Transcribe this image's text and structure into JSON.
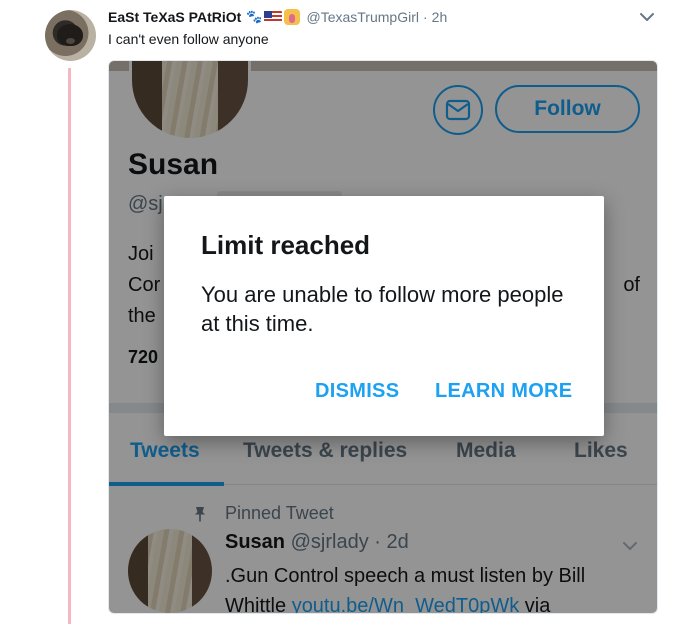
{
  "tweet": {
    "display_name": "EaSt TeXaS PAtRiOt",
    "emojis": [
      "paw-prints-emoji",
      "us-flag-emoji",
      "woman-raising-hand-emoji"
    ],
    "handle": "@TexasTrumpGirl",
    "separator": "·",
    "time": "2h",
    "text": "I can't even follow anyone"
  },
  "screenshot": {
    "profile": {
      "name": "Susan",
      "handle_visible": "@sj",
      "bio_lines": [
        "Joi",
        "Cor",
        "the"
      ],
      "bio_tail": "of",
      "stats_visible": "720",
      "follow_label": "Follow"
    },
    "tabs": [
      {
        "label": "Tweets",
        "active": true
      },
      {
        "label": "Tweets & replies",
        "active": false
      },
      {
        "label": "Media",
        "active": false
      },
      {
        "label": "Likes",
        "active": false
      }
    ],
    "pinned": {
      "label": "Pinned Tweet",
      "name": "Susan",
      "handle": "@sjrlady",
      "separator": "·",
      "time": "2d",
      "text_line1": ".Gun Control speech a must listen by Bill",
      "text_line2_prefix": "Whittle",
      "link": "youtu.be/Wn_WedT0pWk",
      "text_line2_suffix": "via"
    },
    "dialog": {
      "title": "Limit reached",
      "body": "You are unable to follow more people at this time.",
      "dismiss_label": "DISMISS",
      "learn_more_label": "LEARN MORE"
    }
  },
  "colors": {
    "accent": "#1da1f2",
    "thread_line": "#f4b8c4",
    "secondary_text": "#657786"
  }
}
